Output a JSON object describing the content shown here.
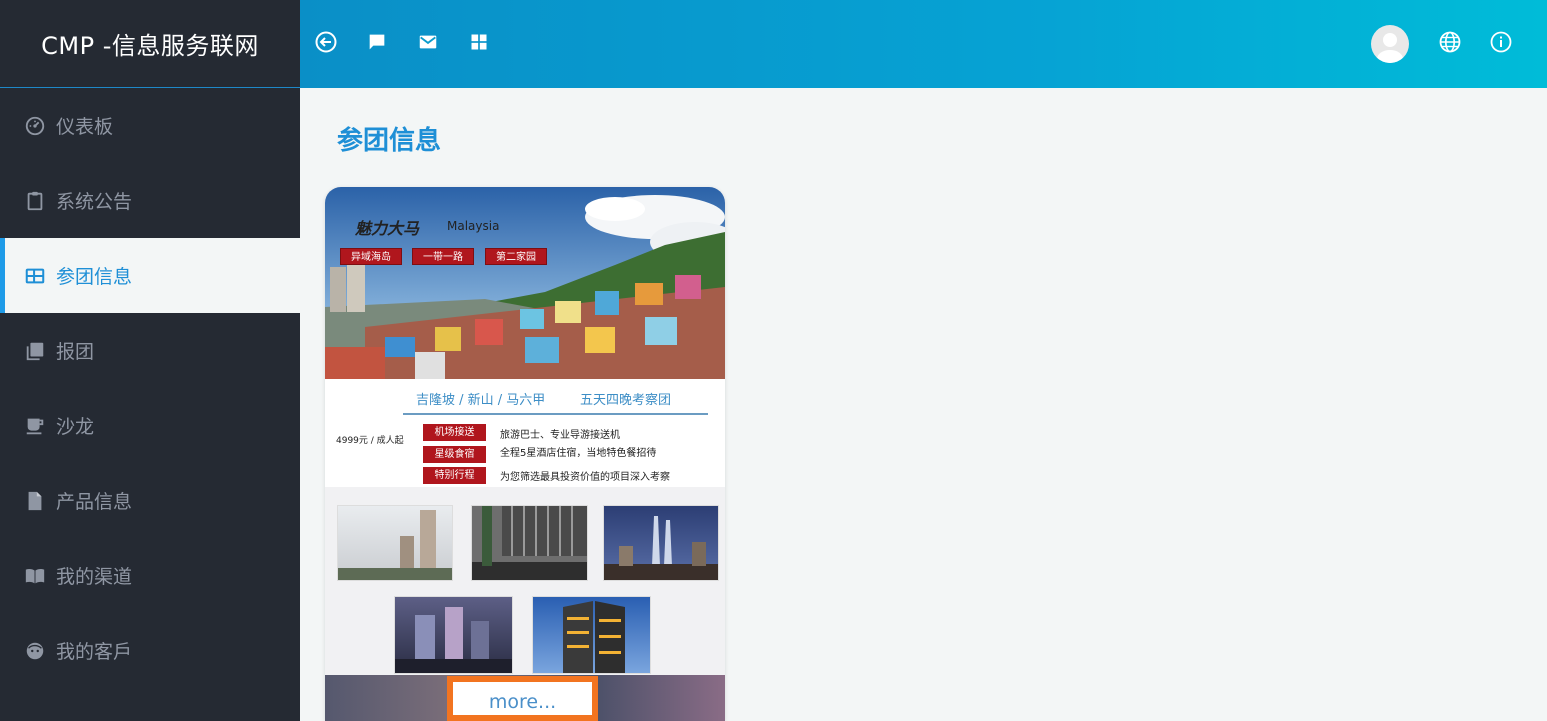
{
  "app": {
    "brand": "CMP -信息服务联网"
  },
  "sidebar": {
    "items": [
      {
        "label": "仪表板",
        "icon": "dashboard-icon",
        "active": false
      },
      {
        "label": "系统公告",
        "icon": "clipboard-icon",
        "active": false
      },
      {
        "label": "参团信息",
        "icon": "table-icon",
        "active": true
      },
      {
        "label": "报团",
        "icon": "library-icon",
        "active": false
      },
      {
        "label": "沙龙",
        "icon": "coffee-icon",
        "active": false
      },
      {
        "label": "产品信息",
        "icon": "file-icon",
        "active": false
      },
      {
        "label": "我的渠道",
        "icon": "book-icon",
        "active": false
      },
      {
        "label": "我的客戶",
        "icon": "face-icon",
        "active": false
      }
    ]
  },
  "header": {
    "icons": [
      "back-icon",
      "chat-icon",
      "mail-icon",
      "apps-grid-icon",
      "globe-icon",
      "info-icon"
    ]
  },
  "main": {
    "title": "参团信息",
    "card": {
      "hero_title": "魅力大马",
      "hero_subtitle": "Malaysia",
      "hero_tags": [
        "异域海岛",
        "一带一路",
        "第二家园"
      ],
      "route": "吉隆坡 / 新山 / 马六甲",
      "tour_name": "五天四晚考察团",
      "price": "4999元 / 成人起",
      "features": [
        {
          "tag": "机场接送",
          "desc": "旅游巴士、专业导游接送机"
        },
        {
          "tag": "星级食宿",
          "desc": "全程5星酒店住宿，当地特色餐招待"
        },
        {
          "tag": "特别行程",
          "desc": "为您筛选最具投资价值的项目深入考察"
        }
      ],
      "more_label": "more..."
    }
  },
  "colors": {
    "sidebar_bg": "#252a33",
    "header_start": "#0a8fc7",
    "header_end": "#00bcd8",
    "accent": "#1e8fd6",
    "tag_red": "#b0161d",
    "highlight": "#f27420"
  }
}
